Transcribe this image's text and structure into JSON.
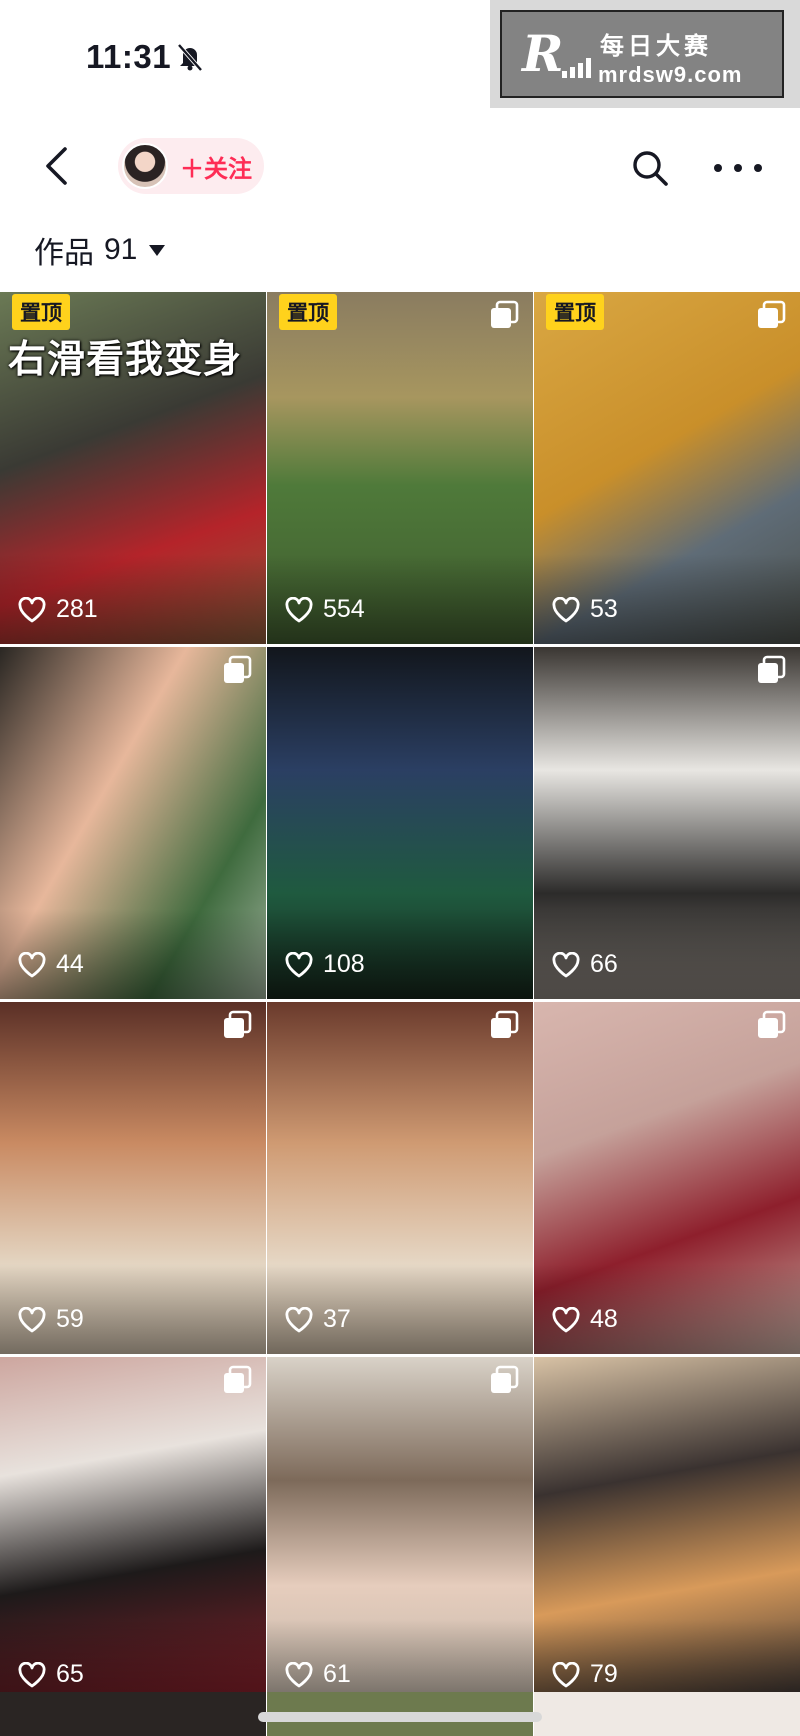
{
  "status_bar": {
    "time": "11:31",
    "icons": [
      "bell-off-icon",
      "signal-icon",
      "wifi-icon",
      "battery-icon"
    ],
    "watermark": {
      "logo": "R",
      "line1": "每日大赛",
      "line2": "mrdsw9.com"
    }
  },
  "nav": {
    "back_icon": "chevron-left-icon",
    "follow_label": "＋关注",
    "search_icon": "search-icon",
    "more_icon": "more-dots-icon"
  },
  "works": {
    "label": "作品",
    "count": "91"
  },
  "colors": {
    "accent": "#fe2c55",
    "pin_badge": "#ffd21c",
    "text": "#161823"
  },
  "grid": {
    "tiles": [
      {
        "likes": "281",
        "pinned": true,
        "pin_label": "置顶",
        "overlay": "右滑看我变身",
        "multi": false,
        "bg": "linear-gradient(160deg,#6b7a55 0%,#3a3a34 40%,#b5242a 70%,#8a5b3a 100%)"
      },
      {
        "likes": "554",
        "pinned": true,
        "pin_label": "置顶",
        "overlay": "",
        "multi": true,
        "bg": "linear-gradient(180deg,#8a7c60 0%,#a7965f 30%,#4f7a3a 55%,#3f5a2e 100%)"
      },
      {
        "likes": "53",
        "pinned": true,
        "pin_label": "置顶",
        "overlay": "",
        "multi": true,
        "bg": "linear-gradient(150deg,#d9a743 0%,#c98f2a 45%,#5f6c77 70%,#4b4f4a 100%)"
      },
      {
        "likes": "44",
        "pinned": false,
        "pin_label": "",
        "overlay": "",
        "multi": true,
        "bg": "linear-gradient(120deg,#2a2723 0%,#e7b79b 40%,#3f6b3e 75%,#9db09a 100%)"
      },
      {
        "likes": "108",
        "pinned": false,
        "pin_label": "",
        "overlay": "",
        "multi": false,
        "bg": "linear-gradient(180deg,#12161c 0%,#2b3f63 35%,#1f5a3f 70%,#15251a 100%)"
      },
      {
        "likes": "66",
        "pinned": false,
        "pin_label": "",
        "overlay": "",
        "multi": true,
        "bg": "linear-gradient(180deg,#3a3632 0%,#e8e6e2 35%,#2c2b2a 70%,#8a837c 100%)"
      },
      {
        "likes": "59",
        "pinned": false,
        "pin_label": "",
        "overlay": "",
        "multi": true,
        "bg": "linear-gradient(180deg,#5a2f26 0%,#c98a62 40%,#e4d6c3 75%,#d2c2ad 100%)"
      },
      {
        "likes": "37",
        "pinned": false,
        "pin_label": "",
        "overlay": "",
        "multi": true,
        "bg": "linear-gradient(180deg,#6a3a2c 0%,#cf9a72 40%,#e6d8c6 75%,#cdbca6 100%)"
      },
      {
        "likes": "48",
        "pinned": false,
        "pin_label": "",
        "overlay": "",
        "multi": true,
        "bg": "linear-gradient(160deg,#d8b6ae 0%,#c5a19a 35%,#8e1f2c 65%,#c9b0a4 100%)"
      },
      {
        "likes": "65",
        "pinned": false,
        "pin_label": "",
        "overlay": "",
        "multi": true,
        "bg": "linear-gradient(170deg,#cda69f 0%,#e8e2dd 30%,#1d1a1a 60%,#8c1f2a 100%)"
      },
      {
        "likes": "61",
        "pinned": false,
        "pin_label": "",
        "overlay": "",
        "multi": true,
        "bg": "linear-gradient(180deg,#d9d2c8 0%,#7d6a5a 35%,#e6cdbd 65%,#bfb5a8 100%)"
      },
      {
        "likes": "79",
        "pinned": false,
        "pin_label": "",
        "overlay": "",
        "multi": false,
        "bg": "linear-gradient(170deg,#d8c2a5 0%,#3a3230 35%,#d89a5a 65%,#2c2a2e 100%)"
      }
    ]
  }
}
